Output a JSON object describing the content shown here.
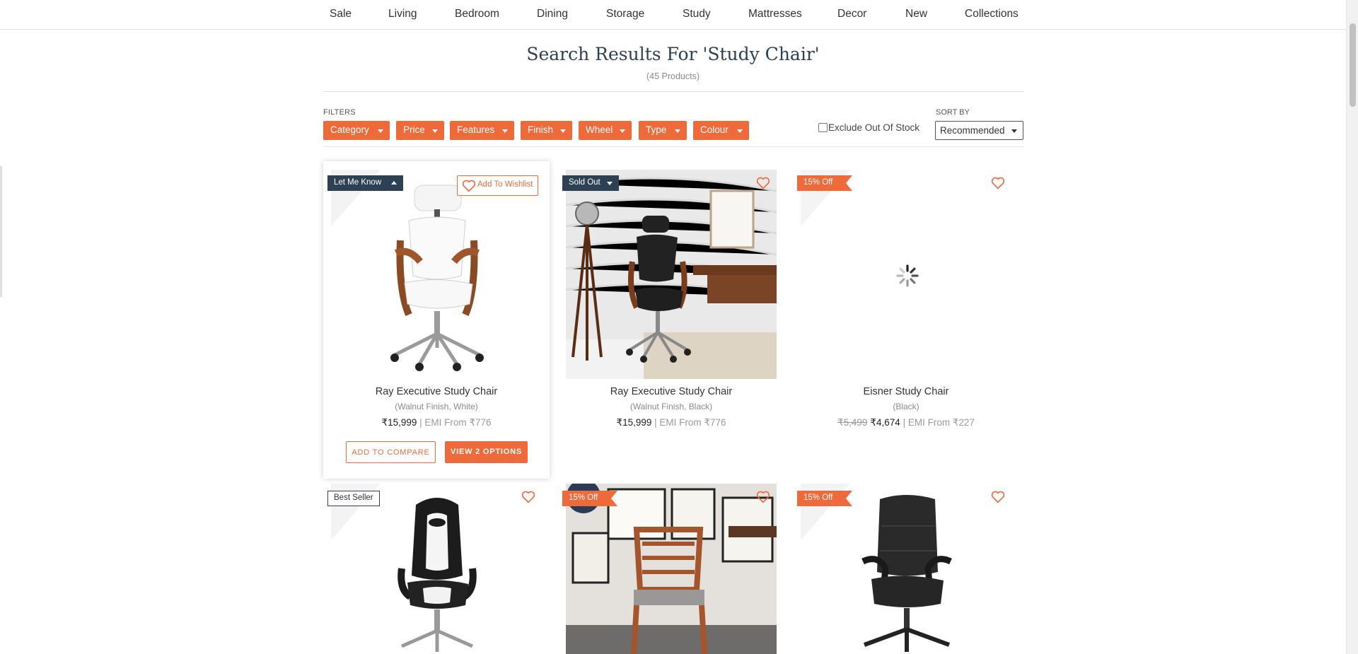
{
  "nav": {
    "items": [
      "Sale",
      "Living",
      "Bedroom",
      "Dining",
      "Storage",
      "Study",
      "Mattresses",
      "Decor",
      "New",
      "Collections"
    ]
  },
  "search": {
    "title": "Search Results For 'Study Chair'",
    "count": "(45 Products)"
  },
  "filters": {
    "label": "FILTERS",
    "buttons": [
      "Category",
      "Price",
      "Features",
      "Finish",
      "Wheel",
      "Type",
      "Colour"
    ],
    "exclude_out_of_stock": "Exclude Out Of Stock",
    "exclude_checked": false
  },
  "sort": {
    "label": "SORT BY",
    "selected": "Recommended"
  },
  "products": [
    {
      "name": "Ray Executive Study Chair",
      "variant": "(Walnut Finish, White)",
      "price": "₹15,999",
      "emi": "| EMI From ₹776",
      "badge": "Let Me Know",
      "wishlist_label": "Add To Wishlist",
      "compare_label": "ADD TO COMPARE",
      "options_label": "VIEW 2 OPTIONS"
    },
    {
      "name": "Ray Executive Study Chair",
      "variant": "(Walnut Finish, Black)",
      "price": "₹15,999",
      "emi": "| EMI From ₹776",
      "badge": "Sold Out"
    },
    {
      "name": "Eisner Study Chair",
      "variant": "(Black)",
      "old_price": "₹5,499",
      "price": "₹4,674",
      "emi": "| EMI From ₹227",
      "badge": "15% Off"
    },
    {
      "badge": "Best Seller"
    },
    {
      "badge": "15% Off"
    },
    {
      "badge": "15% Off"
    }
  ],
  "colors": {
    "accent": "#ee6a3b",
    "navy": "#2d4155"
  }
}
